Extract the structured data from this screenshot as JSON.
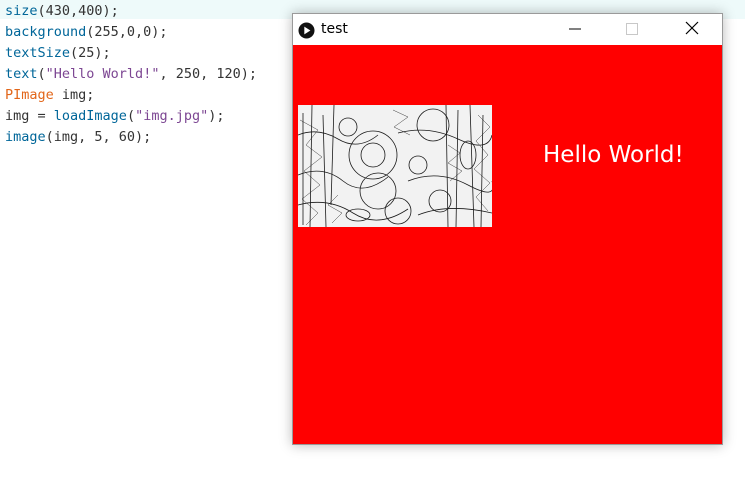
{
  "editor": {
    "lines": [
      [
        {
          "t": "size",
          "c": "fn"
        },
        {
          "t": "(430,400);",
          "c": ""
        }
      ],
      [
        {
          "t": "background",
          "c": "fn"
        },
        {
          "t": "(255,0,0);",
          "c": ""
        }
      ],
      [
        {
          "t": "textSize",
          "c": "fn"
        },
        {
          "t": "(25);",
          "c": ""
        }
      ],
      [
        {
          "t": "text",
          "c": "fn"
        },
        {
          "t": "(",
          "c": ""
        },
        {
          "t": "\"Hello World!\"",
          "c": "str"
        },
        {
          "t": ", 250, 120);",
          "c": ""
        }
      ],
      [
        {
          "t": "PImage",
          "c": "ty"
        },
        {
          "t": " img;",
          "c": ""
        }
      ],
      [
        {
          "t": "img = ",
          "c": ""
        },
        {
          "t": "loadImage",
          "c": "fn"
        },
        {
          "t": "(",
          "c": ""
        },
        {
          "t": "\"img.jpg\"",
          "c": "str"
        },
        {
          "t": ");",
          "c": ""
        }
      ],
      [
        {
          "t": "image",
          "c": "fn"
        },
        {
          "t": "(img, 5, 60);",
          "c": ""
        }
      ]
    ]
  },
  "window": {
    "title": "test",
    "canvas_background": "#ff0000",
    "text": "Hello World!",
    "text_color": "#ffffff"
  },
  "icons": {
    "app": "play-icon",
    "minimize": "minimize-icon",
    "maximize": "maximize-icon",
    "close": "close-icon"
  }
}
